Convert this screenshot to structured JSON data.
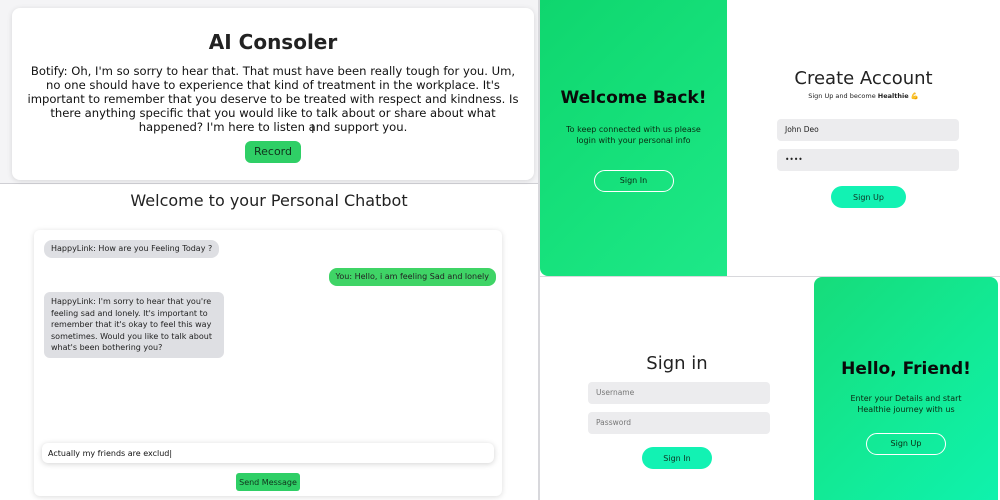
{
  "consoler": {
    "title": "AI Consoler",
    "message": "Botify: Oh, I'm so sorry to hear that. That must have been really tough for you. Um, no one should have to experience that kind of treatment in the workplace. It's important to remember that you deserve to be treated with respect and kindness. Is there anything specific that you would like to talk about or share about what happened? I'm here to listen and support you.",
    "record_label": "Record"
  },
  "chat": {
    "title": "Welcome to your Personal Chatbot",
    "messages": [
      {
        "sender": "bot",
        "text": "HappyLink: How are you Feeling Today ?"
      },
      {
        "sender": "user",
        "text": "You: Hello, i am feeling Sad and lonely"
      },
      {
        "sender": "bot",
        "text": "HappyLink: I'm sorry to hear that you're feeling sad and lonely. It's important to remember that it's okay to feel this way sometimes. Would you like to talk about what's been bothering you?"
      }
    ],
    "input_value": "Actually my friends are exclud|",
    "send_label": "Send Message"
  },
  "signup_panel": {
    "welcome_title": "Welcome Back!",
    "welcome_text": "To keep connected with us please login with your personal info",
    "signin_ghost_label": "Sign In",
    "create_title": "Create Account",
    "subtitle_prefix": "Sign Up and become ",
    "subtitle_brand": "Healthie",
    "subtitle_emoji": "💪",
    "name_value": "John Deo",
    "password_value": "••••",
    "signup_label": "Sign Up"
  },
  "signin_panel": {
    "title": "Sign in",
    "username_placeholder": "Username",
    "password_placeholder": "Password",
    "signin_label": "Sign In",
    "friend_title": "Hello, Friend!",
    "friend_text": "Enter your Details and start Healthie journey with us",
    "signup_ghost_label": "Sign Up"
  },
  "colors": {
    "record_green": "#2fcf66",
    "user_bubble": "#3fd466",
    "bot_bubble": "#dedfe3",
    "panel_green": "#17e27d",
    "mint_button": "#12f2b3",
    "field_bg": "#ececee"
  }
}
